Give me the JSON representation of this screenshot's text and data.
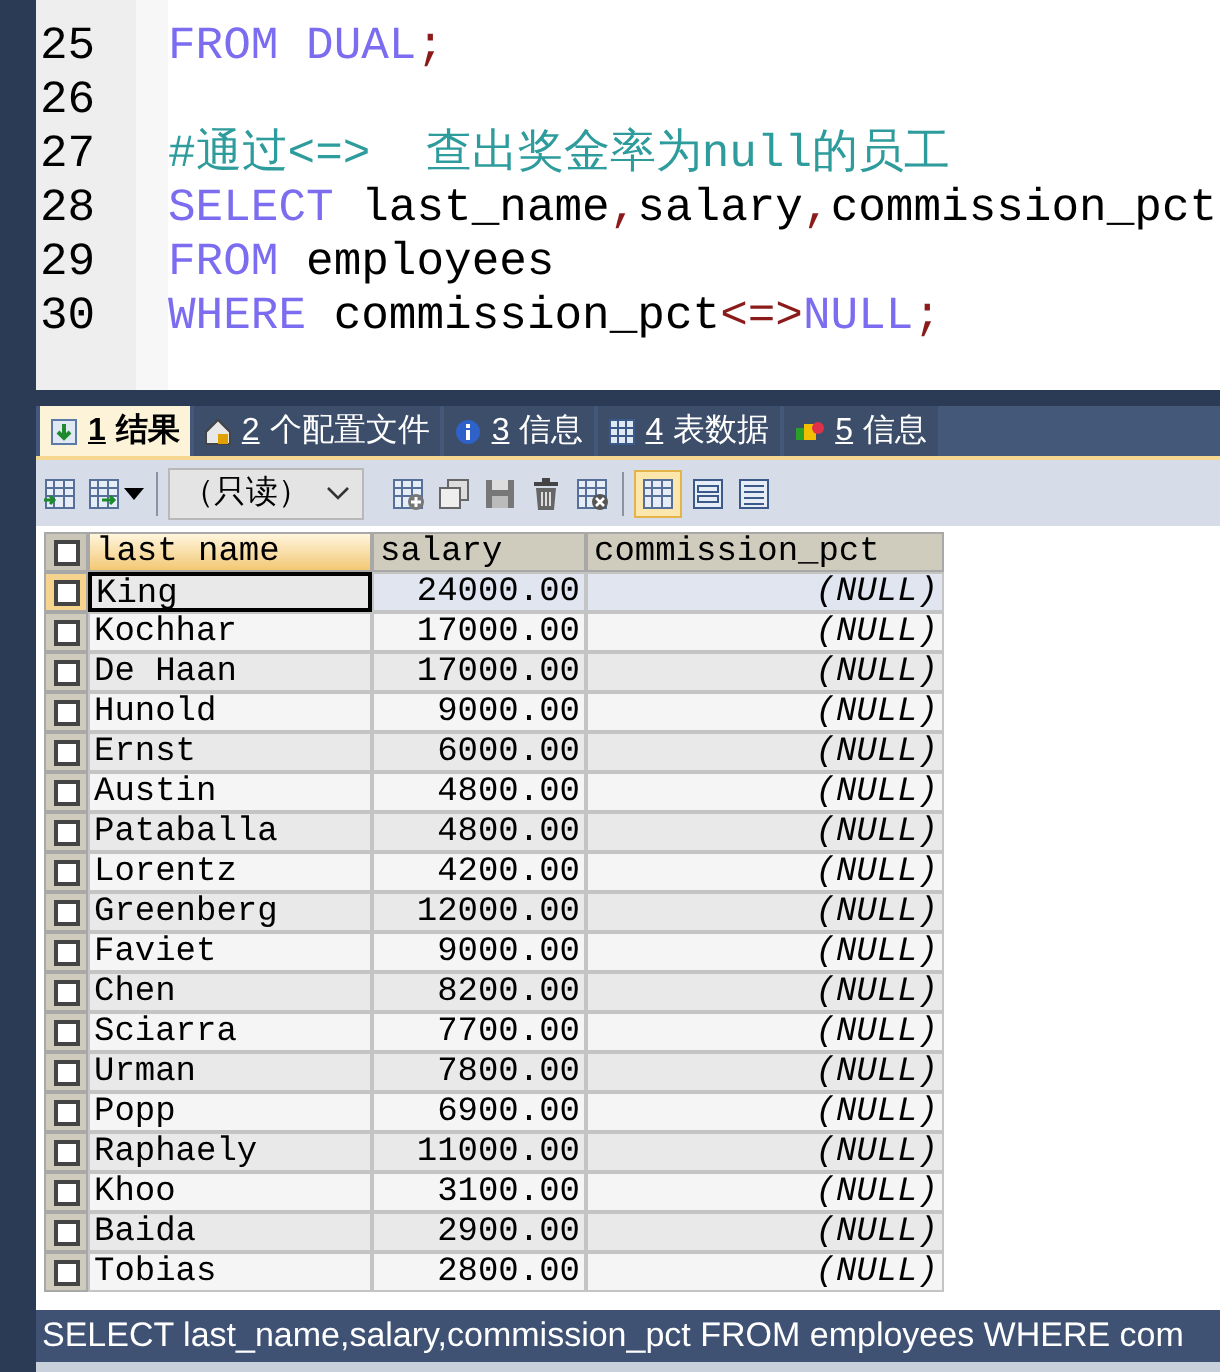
{
  "editor": {
    "lines": [
      {
        "number": "25",
        "tokens": [
          {
            "kind": "keyword",
            "text": "FROM DUAL"
          },
          {
            "kind": "operator",
            "text": ";"
          }
        ]
      },
      {
        "number": "26"
      },
      {
        "number": "27",
        "tokens": [
          {
            "kind": "comment",
            "text": "#通过<=>  查出奖金率为null的员工"
          }
        ]
      },
      {
        "number": "28",
        "tokens": [
          {
            "kind": "keyword",
            "text": "SELECT "
          },
          {
            "kind": "plain",
            "text": "last_name"
          },
          {
            "kind": "operator",
            "text": ","
          },
          {
            "kind": "plain",
            "text": "salary"
          },
          {
            "kind": "operator",
            "text": ","
          },
          {
            "kind": "plain",
            "text": "commission_pct"
          }
        ]
      },
      {
        "number": "29",
        "tokens": [
          {
            "kind": "keyword",
            "text": "FROM "
          },
          {
            "kind": "plain",
            "text": "employees"
          }
        ]
      },
      {
        "number": "30",
        "tokens": [
          {
            "kind": "keyword",
            "text": "WHERE "
          },
          {
            "kind": "plain",
            "text": "commission_pct"
          },
          {
            "kind": "operator",
            "text": "<=>"
          },
          {
            "kind": "keyword",
            "text": "NULL"
          },
          {
            "kind": "operator",
            "text": ";"
          }
        ]
      }
    ]
  },
  "tabs": [
    {
      "number": "1",
      "label": "结果",
      "selected": true
    },
    {
      "number": "2",
      "label": "个配置文件",
      "selected": false
    },
    {
      "number": "3",
      "label": "信息",
      "selected": false
    },
    {
      "number": "4",
      "label": "表数据",
      "selected": false
    },
    {
      "number": "5",
      "label": "信息",
      "selected": false
    }
  ],
  "toolbar": {
    "mode_dropdown": "（只读）"
  },
  "table": {
    "select_all_checked": false,
    "columns": [
      "last name",
      "salary",
      "commission_pct"
    ],
    "rows": [
      {
        "cells": [
          "King",
          "24000.00",
          "(NULL)"
        ],
        "selected": true
      },
      {
        "cells": [
          "Kochhar",
          "17000.00",
          "(NULL)"
        ],
        "selected": false
      },
      {
        "cells": [
          "De Haan",
          "17000.00",
          "(NULL)"
        ],
        "selected": false
      },
      {
        "cells": [
          "Hunold",
          "9000.00",
          "(NULL)"
        ],
        "selected": false
      },
      {
        "cells": [
          "Ernst",
          "6000.00",
          "(NULL)"
        ],
        "selected": false
      },
      {
        "cells": [
          "Austin",
          "4800.00",
          "(NULL)"
        ],
        "selected": false
      },
      {
        "cells": [
          "Pataballa",
          "4800.00",
          "(NULL)"
        ],
        "selected": false
      },
      {
        "cells": [
          "Lorentz",
          "4200.00",
          "(NULL)"
        ],
        "selected": false
      },
      {
        "cells": [
          "Greenberg",
          "12000.00",
          "(NULL)"
        ],
        "selected": false
      },
      {
        "cells": [
          "Faviet",
          "9000.00",
          "(NULL)"
        ],
        "selected": false
      },
      {
        "cells": [
          "Chen",
          "8200.00",
          "(NULL)"
        ],
        "selected": false
      },
      {
        "cells": [
          "Sciarra",
          "7700.00",
          "(NULL)"
        ],
        "selected": false
      },
      {
        "cells": [
          "Urman",
          "7800.00",
          "(NULL)"
        ],
        "selected": false
      },
      {
        "cells": [
          "Popp",
          "6900.00",
          "(NULL)"
        ],
        "selected": false
      },
      {
        "cells": [
          "Raphaely",
          "11000.00",
          "(NULL)"
        ],
        "selected": false
      },
      {
        "cells": [
          "Khoo",
          "3100.00",
          "(NULL)"
        ],
        "selected": false
      },
      {
        "cells": [
          "Baida",
          "2900.00",
          "(NULL)"
        ],
        "selected": false
      },
      {
        "cells": [
          "Tobias",
          "2800.00",
          "(NULL)"
        ],
        "selected": false
      }
    ]
  },
  "status_bar": "SELECT last_name,salary,commission_pct FROM employees WHERE com"
}
